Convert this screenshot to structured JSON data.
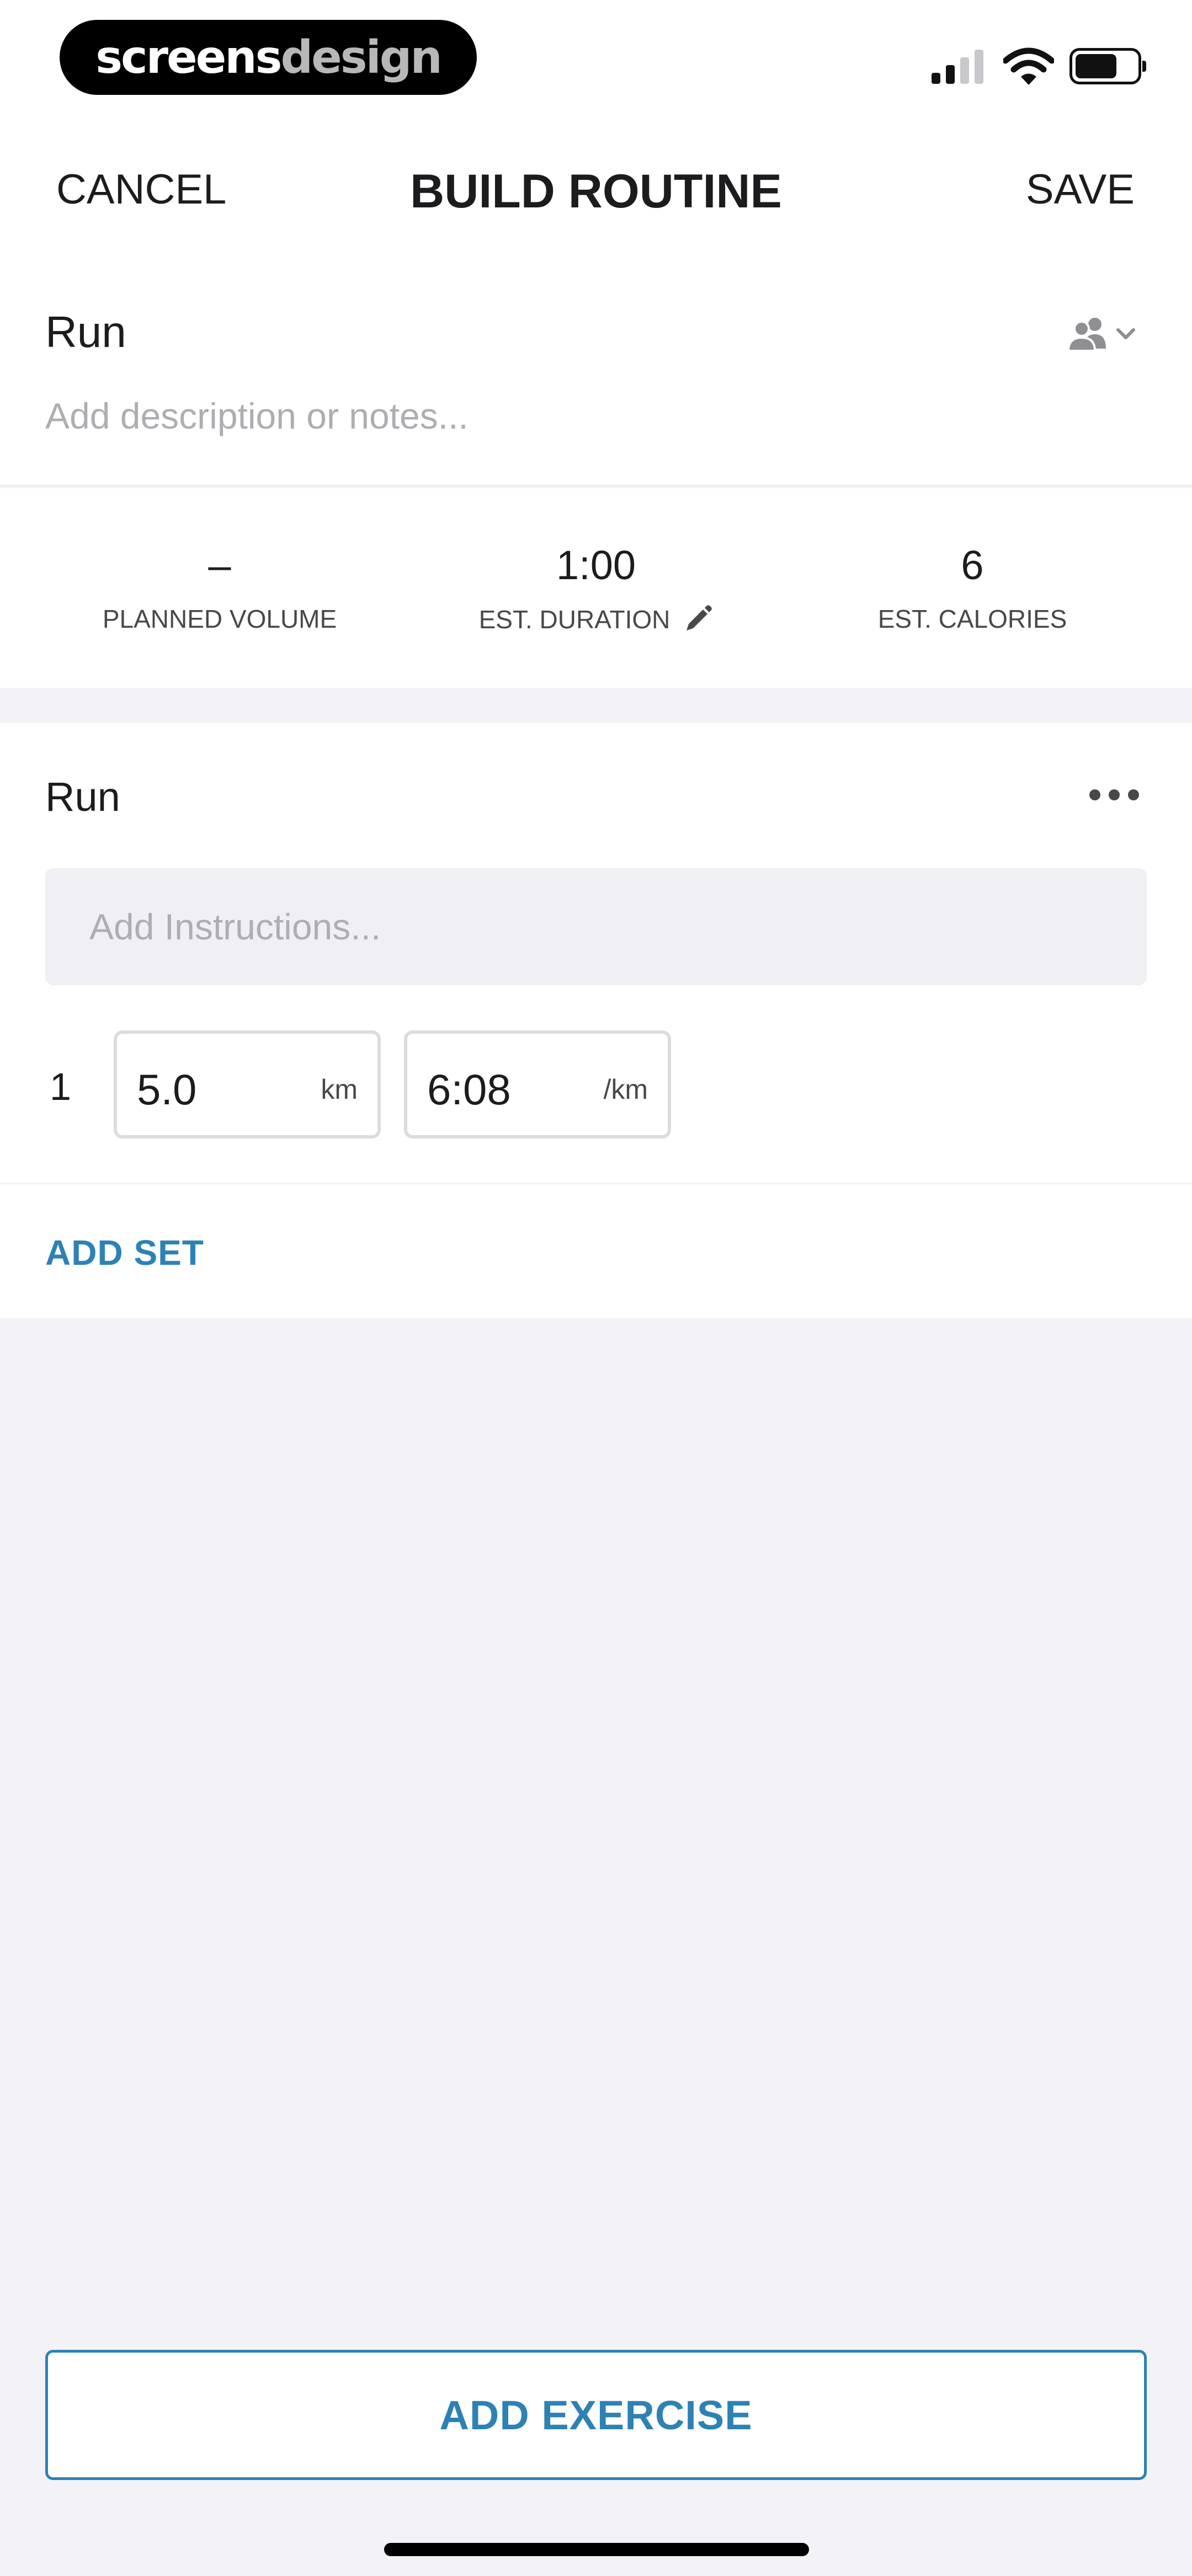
{
  "status_bar": {
    "brand_part1": "screens",
    "brand_part2": "design"
  },
  "nav": {
    "cancel_label": "CANCEL",
    "title": "BUILD ROUTINE",
    "save_label": "SAVE"
  },
  "routine": {
    "name": "Run",
    "description_placeholder": "Add description or notes...",
    "share_icon": "people-icon"
  },
  "stats": [
    {
      "value": "–",
      "label": "PLANNED VOLUME"
    },
    {
      "value": "1:00",
      "label": "EST. DURATION",
      "icon": "pencil-icon"
    },
    {
      "value": "6",
      "label": "EST. CALORIES"
    }
  ],
  "exercise": {
    "name": "Run",
    "menu_icon": "more-icon",
    "instructions_placeholder": "Add Instructions...",
    "sets": [
      {
        "number": "1",
        "distance": "5.0",
        "distance_unit": "km",
        "pace": "6:08",
        "pace_unit": "/km"
      }
    ],
    "add_set_label": "ADD SET"
  },
  "footer": {
    "add_exercise_label": "ADD EXERCISE"
  },
  "colors": {
    "accent": "#2d82b5",
    "background": "#f2f2f7",
    "card": "#ffffff",
    "placeholder": "#aeaeb2"
  }
}
